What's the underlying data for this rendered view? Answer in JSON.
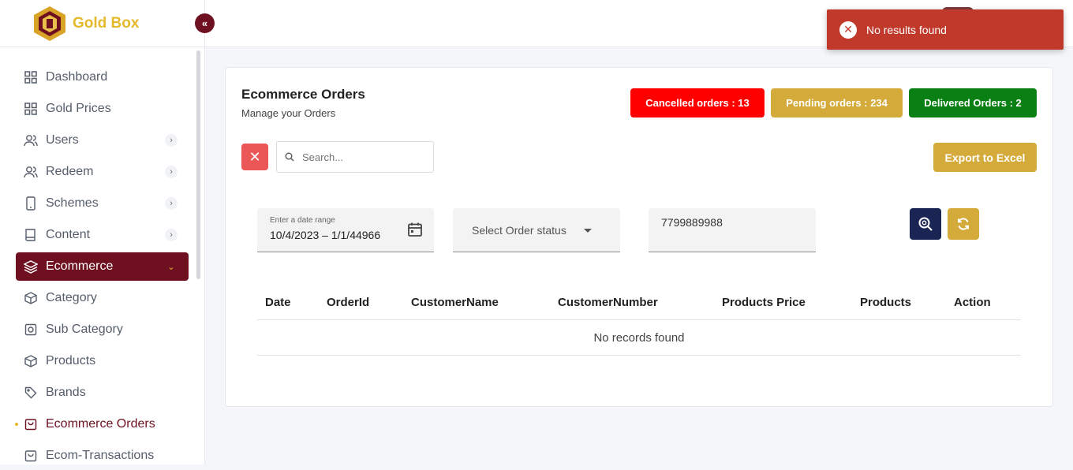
{
  "app": {
    "name": "Gold Box"
  },
  "toast": {
    "message": "No results found"
  },
  "sidebar": {
    "items": [
      {
        "label": "Dashboard"
      },
      {
        "label": "Gold Prices"
      },
      {
        "label": "Users"
      },
      {
        "label": "Redeem"
      },
      {
        "label": "Schemes"
      },
      {
        "label": "Content"
      },
      {
        "label": "Ecommerce"
      },
      {
        "label": "Category"
      },
      {
        "label": "Sub Category"
      },
      {
        "label": "Products"
      },
      {
        "label": "Brands"
      },
      {
        "label": "Ecommerce Orders"
      },
      {
        "label": "Ecom-Transactions"
      }
    ]
  },
  "page": {
    "title": "Ecommerce Orders",
    "subtitle": "Manage your Orders"
  },
  "badges": {
    "cancelled": "Cancelled orders : 13",
    "pending": "Pending orders : 234",
    "delivered": "Delivered Orders : 2"
  },
  "search": {
    "placeholder": "Search..."
  },
  "export_label": "Export to Excel",
  "filters": {
    "date_label": "Enter a date range",
    "date_value": "10/4/2023 – 1/1/44966",
    "status_placeholder": "Select Order status",
    "phone_value": "7799889988"
  },
  "table": {
    "columns": [
      "Date",
      "OrderId",
      "CustomerName",
      "CustomerNumber",
      "Products Price",
      "Products",
      "Action"
    ],
    "empty_message": "No records found"
  },
  "colors": {
    "brand": "#6e1020",
    "gold": "#d4aa3a",
    "cancelled": "#ff0000",
    "delivered": "#0a7f14",
    "toast": "#c0392b",
    "navy": "#1b2553"
  }
}
